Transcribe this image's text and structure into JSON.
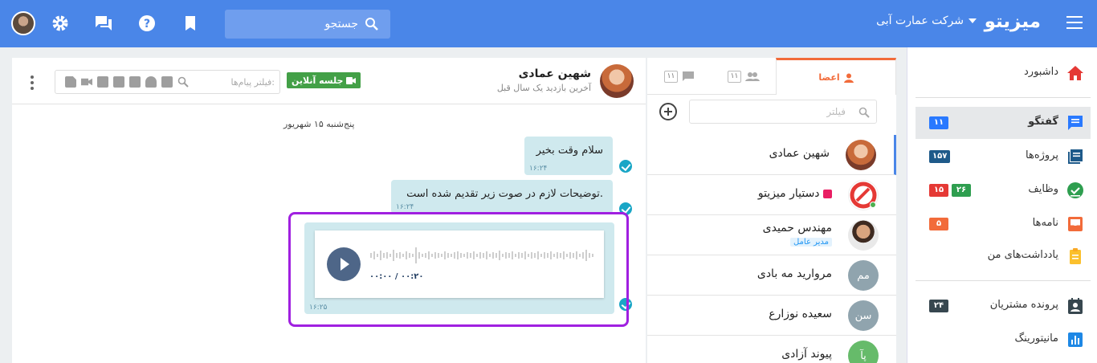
{
  "topbar": {
    "brand": "میزیتو",
    "company": "شرکت عمارت آبی",
    "search_placeholder": "جستجو",
    "icons": [
      "menu-icon",
      "search-icon",
      "bookmark-icon",
      "help-icon",
      "chat-icon",
      "gear-icon"
    ]
  },
  "sidebar": {
    "items": [
      {
        "label": "داشبورد",
        "icon": "home-icon",
        "color": "#e53935"
      },
      {
        "label": "گفتگو",
        "icon": "chat-icon",
        "color": "#2979ff",
        "badges": [
          "۱۱"
        ]
      },
      {
        "label": "پروژه‌ها",
        "icon": "projects-icon",
        "color": "#1e5a8a",
        "badges": [
          "۱۵۷"
        ]
      },
      {
        "label": "وظایف",
        "icon": "tasks-icon",
        "color": "#2e9e4f",
        "badges": [
          "۲۶",
          "۱۵"
        ]
      },
      {
        "label": "نامه‌ها",
        "icon": "inbox-icon",
        "color": "#f26b3a",
        "badges": [
          "۵"
        ]
      },
      {
        "label": "یادداشت‌های من",
        "icon": "notes-icon",
        "color": "#fbc02d"
      },
      {
        "label": "پرونده مشتریان",
        "icon": "contacts-icon",
        "color": "#37474f",
        "badges": [
          "۲۴"
        ]
      },
      {
        "label": "مانیتورینگ",
        "icon": "monitoring-icon",
        "color": "#1e88e5"
      }
    ]
  },
  "contacts": {
    "tabs": [
      {
        "label": "",
        "count": "۱۱",
        "icon": "chat-icon"
      },
      {
        "label": "",
        "count": "۱۱",
        "icon": "group-icon"
      },
      {
        "label": "اعضا",
        "icon": "person-icon"
      }
    ],
    "filter_placeholder": "فیلتر",
    "list": [
      {
        "name": "شهین عمادی",
        "avatar": "photo",
        "color": "#c86a3a"
      },
      {
        "name": "دستیار میزیتو",
        "avatar": "logo",
        "color": "#e53935"
      },
      {
        "name": "مهندس حمیدی",
        "role": "مدیر عامل",
        "avatar": "photo",
        "color": "#6d4c41"
      },
      {
        "name": "مروارید مه بادی",
        "avatar": "مم",
        "color": "#90a4ae"
      },
      {
        "name": "سعیده نوزارع",
        "avatar": "سن",
        "color": "#90a4ae"
      },
      {
        "name": "پیوند آزادی",
        "avatar": "پآ",
        "color": "#66bb6a"
      }
    ]
  },
  "chat": {
    "user_name": "شهین عمادی",
    "last_seen": "آخرین بازدید یک سال قبل",
    "live_button": "جلسه آنلاین",
    "filter_placeholder": "فیلتر پیام‌ها:",
    "date_separator": "پنج‌شنبه ۱۵ شهریور",
    "messages": [
      {
        "text": "سلام وقت بخیر",
        "time": "۱۶:۲۴"
      },
      {
        "text": "توضیحات لازم در صوت زیر تقدیم شده است.",
        "time": "۱۶:۲۴"
      }
    ],
    "audio": {
      "time": "۱۶:۲۵",
      "progress_text": "۰۰:۰۰ / ۰۰:۲۰"
    }
  }
}
